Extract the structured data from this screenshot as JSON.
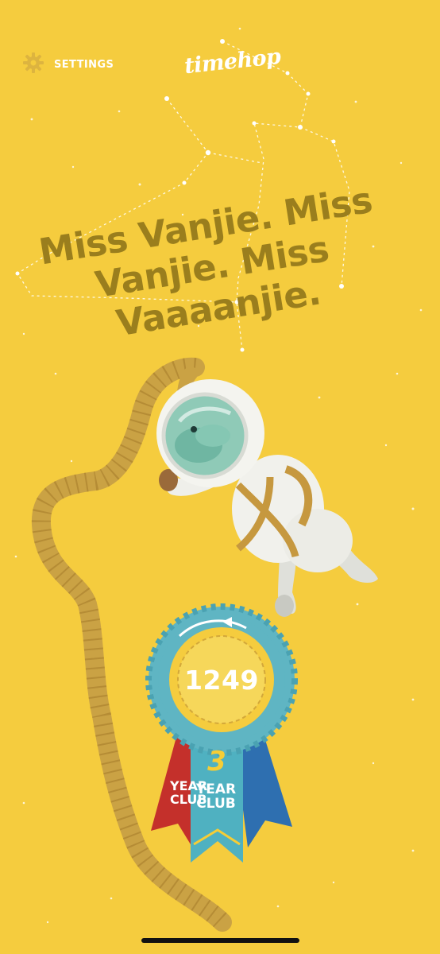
{
  "header": {
    "settings_label": "SETTINGS",
    "settings_icon": "gear-icon",
    "logo_text": "timehop"
  },
  "memory": {
    "quote": "Miss Vanjie. Miss Vanjie. Miss Vaaaanjie."
  },
  "streak_badge": {
    "count": "1249",
    "years": "3",
    "club_line1": "YEAR",
    "club_line2": "CLUB",
    "back_ribbon_line1": "YEAR",
    "back_ribbon_line2": "CLUB"
  },
  "colors": {
    "background": "#f5cc3e",
    "quote_text": "#9a7e1d",
    "badge_teal": "#5fb5c3",
    "ribbon_red": "#c4302b",
    "ribbon_blue": "#2e6fb0",
    "ribbon_teal": "#4fb1c1",
    "number_gold": "#f6cd35"
  }
}
